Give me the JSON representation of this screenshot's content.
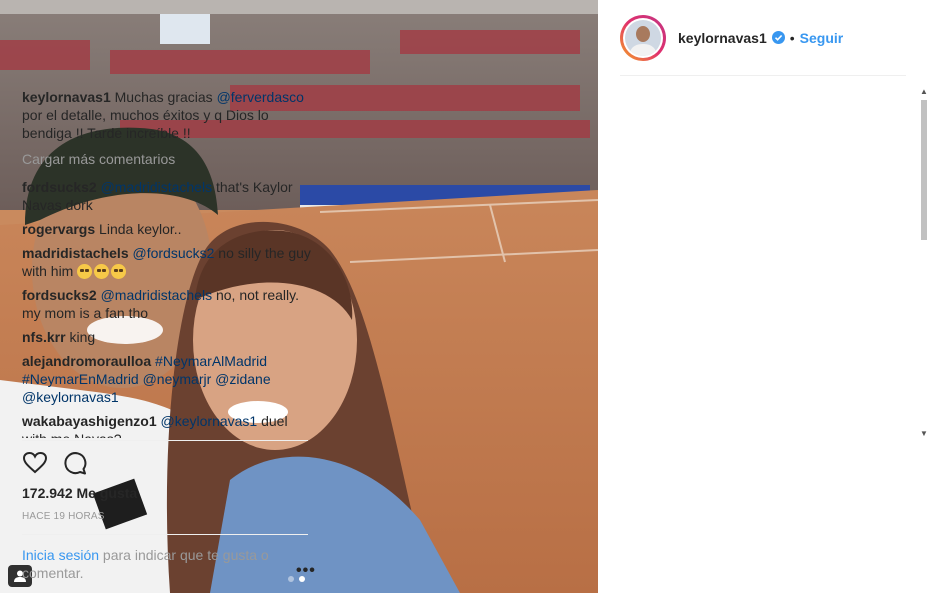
{
  "post": {
    "author": "keylornavas1",
    "follow_label": "Seguir",
    "separator": "•"
  },
  "caption": {
    "user": "keylornavas1",
    "text_before": " Muchas gracias ",
    "mention": "@ferverdasco",
    "text_after": " por el detalle, muchos éxitos y q Dios lo bendiga !! Tarde increíble !!"
  },
  "load_more_label": "Cargar más comentarios",
  "comments": [
    {
      "user": "fordsucks2",
      "mention": "@madridistachels",
      "text": " that's Kaylor Navas dork"
    },
    {
      "user": "rogervargs",
      "mention": "",
      "text": " Linda keylor.."
    },
    {
      "user": "madridistachels",
      "mention": "@fordsucks2",
      "text": " no silly the guy with him "
    },
    {
      "user": "fordsucks2",
      "mention": "@madridistachels",
      "text": " no, not really. my mom is a fan tho"
    },
    {
      "user": "nfs.krr",
      "mention": "",
      "text": " king"
    },
    {
      "user": "alejandromoraulloa",
      "mention": "#NeymarAlMadrid #NeymarEnMadrid @neymarjr @zidane @keylornavas1",
      "text": ""
    },
    {
      "user": "wakabayashigenzo1",
      "mention": "@keylornavas1",
      "text": " duel with me Navas?"
    }
  ],
  "likes": {
    "count": "172.942",
    "label": "Me gusta"
  },
  "time_ago": "HACE 19 HORAS",
  "login": {
    "link": "Inicia sesión",
    "rest": " para indicar que te gusta o comentar."
  },
  "more_label": "•••",
  "icons": {
    "verified": "verified-badge-icon",
    "like": "heart-icon",
    "comment": "comment-bubble-icon",
    "tag": "user-tag-icon"
  },
  "colors": {
    "link": "#3897f0",
    "mention": "#003569",
    "muted": "#999999"
  }
}
